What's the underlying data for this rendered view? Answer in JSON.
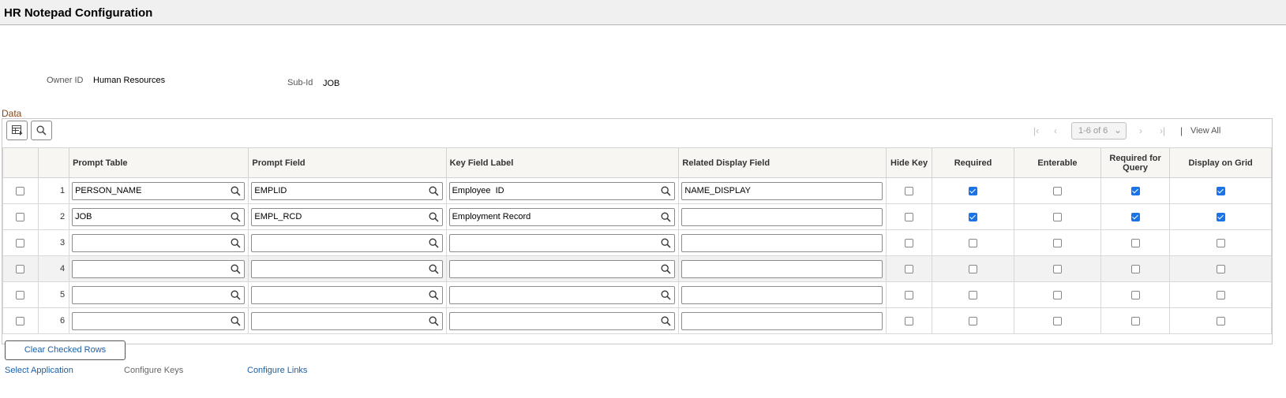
{
  "page": {
    "title": "HR Notepad Configuration"
  },
  "header": {
    "owner_label": "Owner ID",
    "owner_value": "Human Resources",
    "subid_label": "Sub-Id",
    "subid_value": "JOB"
  },
  "section": {
    "label": "Data"
  },
  "toolbar": {
    "personalize_icon": "grid-personalize-icon",
    "find_icon": "search-icon",
    "pager": {
      "range": "1-6 of 6",
      "view_all": "View All"
    }
  },
  "columns": {
    "prompt_table": "Prompt Table",
    "prompt_field": "Prompt Field",
    "key_field_label": "Key Field Label",
    "related_display_field": "Related Display Field",
    "hide_key": "Hide Key",
    "required": "Required",
    "enterable": "Enterable",
    "required_for_query": "Required for Query",
    "display_on_grid": "Display on Grid"
  },
  "rows": [
    {
      "num": "1",
      "prompt_table": "PERSON_NAME",
      "prompt_field": "EMPLID",
      "key_field_label": "Employee  ID",
      "related_display_field": "NAME_DISPLAY",
      "hide_key": false,
      "required": true,
      "enterable": false,
      "required_for_query": true,
      "display_on_grid": true
    },
    {
      "num": "2",
      "prompt_table": "JOB",
      "prompt_field": "EMPL_RCD",
      "key_field_label": "Employment Record",
      "related_display_field": "",
      "hide_key": false,
      "required": true,
      "enterable": false,
      "required_for_query": true,
      "display_on_grid": true
    },
    {
      "num": "3",
      "prompt_table": "",
      "prompt_field": "",
      "key_field_label": "",
      "related_display_field": "",
      "hide_key": false,
      "required": false,
      "enterable": false,
      "required_for_query": false,
      "display_on_grid": false
    },
    {
      "num": "4",
      "prompt_table": "",
      "prompt_field": "",
      "key_field_label": "",
      "related_display_field": "",
      "hide_key": false,
      "required": false,
      "enterable": false,
      "required_for_query": false,
      "display_on_grid": false
    },
    {
      "num": "5",
      "prompt_table": "",
      "prompt_field": "",
      "key_field_label": "",
      "related_display_field": "",
      "hide_key": false,
      "required": false,
      "enterable": false,
      "required_for_query": false,
      "display_on_grid": false
    },
    {
      "num": "6",
      "prompt_table": "",
      "prompt_field": "",
      "key_field_label": "",
      "related_display_field": "",
      "hide_key": false,
      "required": false,
      "enterable": false,
      "required_for_query": false,
      "display_on_grid": false
    }
  ],
  "actions": {
    "clear_checked_rows": "Clear Checked Rows"
  },
  "footer_links": {
    "select_application": "Select Application",
    "configure_keys": "Configure Keys",
    "configure_links": "Configure Links"
  },
  "colors": {
    "accent": "#1a73e8",
    "link": "#1a5fa8",
    "section": "#8b4513"
  }
}
